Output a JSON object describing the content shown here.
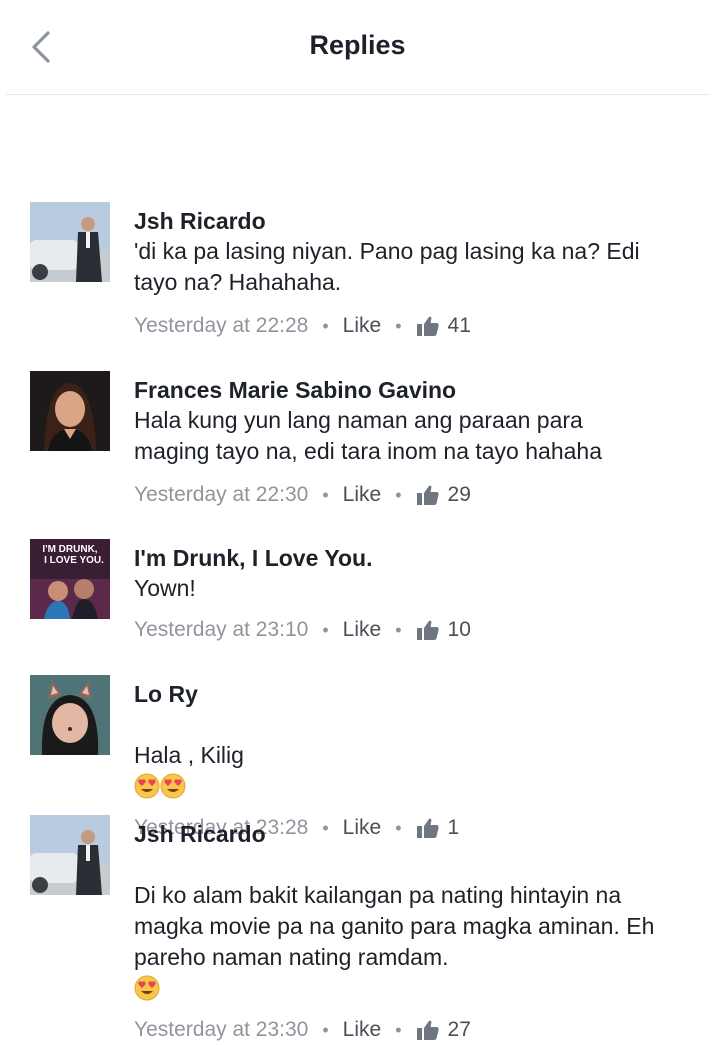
{
  "header": {
    "title": "Replies",
    "back_icon": "chevron-left-icon"
  },
  "like_label": "Like",
  "comments": [
    {
      "name": "Jsh Ricardo",
      "text": "'di ka pa lasing niyan. Pano pag lasing ka na? Edi tayo na? Hahahaha.",
      "time": "Yesterday at 22:28",
      "likes": "41",
      "avatar": "avatar-man-suit"
    },
    {
      "name": "Frances Marie Sabino Gavino",
      "text": "Hala kung yun lang naman ang paraan para maging tayo na, edi tara inom na tayo hahaha",
      "time": "Yesterday at 22:30",
      "likes": "29",
      "avatar": "avatar-woman"
    },
    {
      "name": "I'm Drunk, I Love You.",
      "text": "Yown!",
      "time": "Yesterday at 23:10",
      "likes": "10",
      "avatar": "avatar-movie-poster",
      "avatar_text": "I'M DRUNK, I LOVE YOU."
    },
    {
      "name": "Lo Ry",
      "text": "Hala , Kilig",
      "time": "Yesterday at 23:28",
      "likes": "1",
      "avatar": "avatar-cat-filter"
    },
    {
      "name": "Jsh Ricardo",
      "text": "Di ko alam bakit kailangan pa nating hintayin na magka movie pa na ganito para magka aminan. Eh pareho naman nating ramdam.",
      "time": "Yesterday at 23:30",
      "likes": "27",
      "avatar": "avatar-man-suit"
    }
  ]
}
